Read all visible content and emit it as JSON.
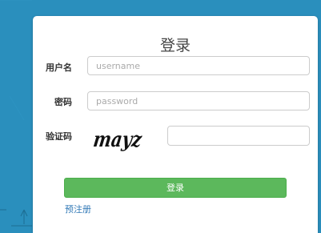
{
  "login": {
    "title": "登录",
    "username_label": "用户名",
    "username_placeholder": "username",
    "password_label": "密码",
    "password_placeholder": "password",
    "captcha_label": "验证码",
    "captcha_text": "mayz",
    "captcha_value": "",
    "submit_label": "登录",
    "register_link": "预注册"
  },
  "colors": {
    "background": "#2a8fbd",
    "card": "#ffffff",
    "primary_button": "#5cb85c",
    "link": "#337ab7"
  }
}
